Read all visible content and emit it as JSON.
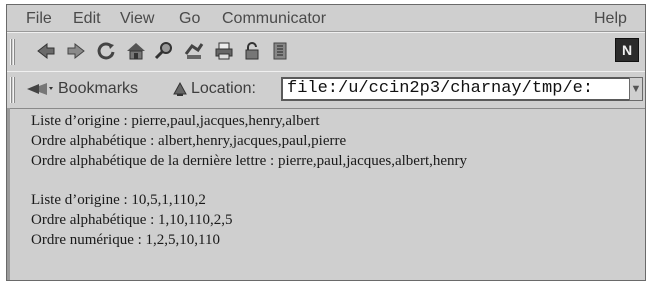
{
  "menubar": {
    "items": [
      "File",
      "Edit",
      "View",
      "Go",
      "Communicator"
    ],
    "help": "Help"
  },
  "toolbar": {
    "buttons": [
      {
        "name": "back-icon"
      },
      {
        "name": "forward-icon"
      },
      {
        "name": "reload-icon"
      },
      {
        "name": "home-icon"
      },
      {
        "name": "search-icon"
      },
      {
        "name": "guide-icon"
      },
      {
        "name": "print-icon"
      },
      {
        "name": "security-icon"
      },
      {
        "name": "stop-icon"
      }
    ],
    "logo_letter": "N"
  },
  "location_bar": {
    "bookmarks_label": "Bookmarks",
    "location_label": "Location:",
    "url": "file:/u/ccin2p3/charnay/tmp/e:"
  },
  "content": {
    "block1": [
      "Liste d’origine : pierre,paul,jacques,henry,albert",
      "Ordre alphabétique : albert,henry,jacques,paul,pierre",
      "Ordre alphabétique de la dernière lettre : pierre,paul,jacques,albert,henry"
    ],
    "block2": [
      "Liste d’origine : 10,5,1,110,2",
      "Ordre alphabétique : 1,10,110,2,5",
      "Ordre numérique : 1,2,5,10,110"
    ]
  }
}
